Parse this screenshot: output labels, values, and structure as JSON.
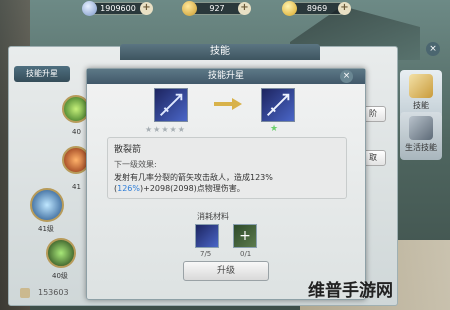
{
  "currency": {
    "silver": "1909600",
    "gold": "927",
    "ingot": "8969",
    "plus": "+"
  },
  "skill_panel": {
    "title": "技能",
    "close": "×",
    "tab_upgrade": "技能升星",
    "levels": [
      "40",
      "41",
      "41级",
      "40级"
    ],
    "right_buttons": [
      "阶",
      "取"
    ],
    "bottom_count": "153603"
  },
  "right_tabs": [
    {
      "label": "技能"
    },
    {
      "label": "生活技能"
    }
  ],
  "dialog": {
    "title": "技能升星",
    "close": "×",
    "stars": "★★★★★",
    "new_star": "★",
    "skill_name": "散裂箭",
    "next_level_label": "下一级效果:",
    "desc_part1": "发射有几率分裂的箭矢攻击敌人，造成123%(",
    "desc_highlight": "126%",
    "desc_part2": ")+2098(2098)点物理伤害。",
    "materials_title": "消耗材料",
    "material_counts": [
      "7/5",
      "0/1"
    ],
    "material_plus": "+",
    "upgrade_button": "升级"
  },
  "watermark": "维普手游网",
  "colors": {
    "header": "#41596a",
    "highlight": "#2f7ed8",
    "new_star": "#6dcf6d"
  }
}
